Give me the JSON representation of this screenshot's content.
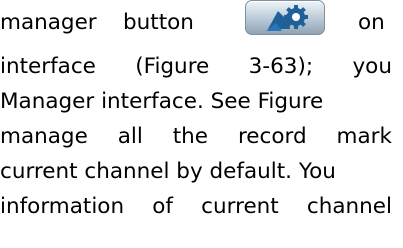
{
  "line1": {
    "part1": "manager",
    "part2": "button",
    "on": "on"
  },
  "line2": {
    "w1": "interface",
    "w2": "(Figure",
    "w3": "3-63);",
    "w4": "you"
  },
  "line3": "Manager interface. See Figure",
  "line4": {
    "w1": "manage",
    "w2": "all",
    "w3": "the",
    "w4": "record",
    "w5": "mark"
  },
  "line5": "current channel by default. You",
  "line6": {
    "w1": "information",
    "w2": "of",
    "w3": "current",
    "w4": "channel"
  },
  "icon": {
    "name": "manager-icon",
    "accent": "#1f5f9a"
  }
}
